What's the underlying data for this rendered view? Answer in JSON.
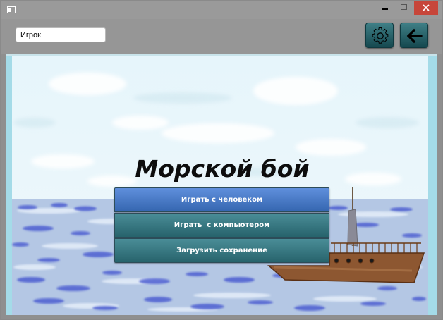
{
  "window": {
    "controls": [
      "minimize-icon",
      "maximize-icon",
      "close-icon"
    ],
    "close_color": "#c7463a"
  },
  "toolbar": {
    "player_name": "Игрок",
    "settings_icon": "gear-icon",
    "back_icon": "arrow-left-icon",
    "button_color": "#1f5a62"
  },
  "main": {
    "title": "Морской бой",
    "menu": [
      {
        "label": "Играть с человеком"
      },
      {
        "label": "Играть  с компьютером"
      },
      {
        "label": "Загрузить сохранение"
      }
    ]
  }
}
